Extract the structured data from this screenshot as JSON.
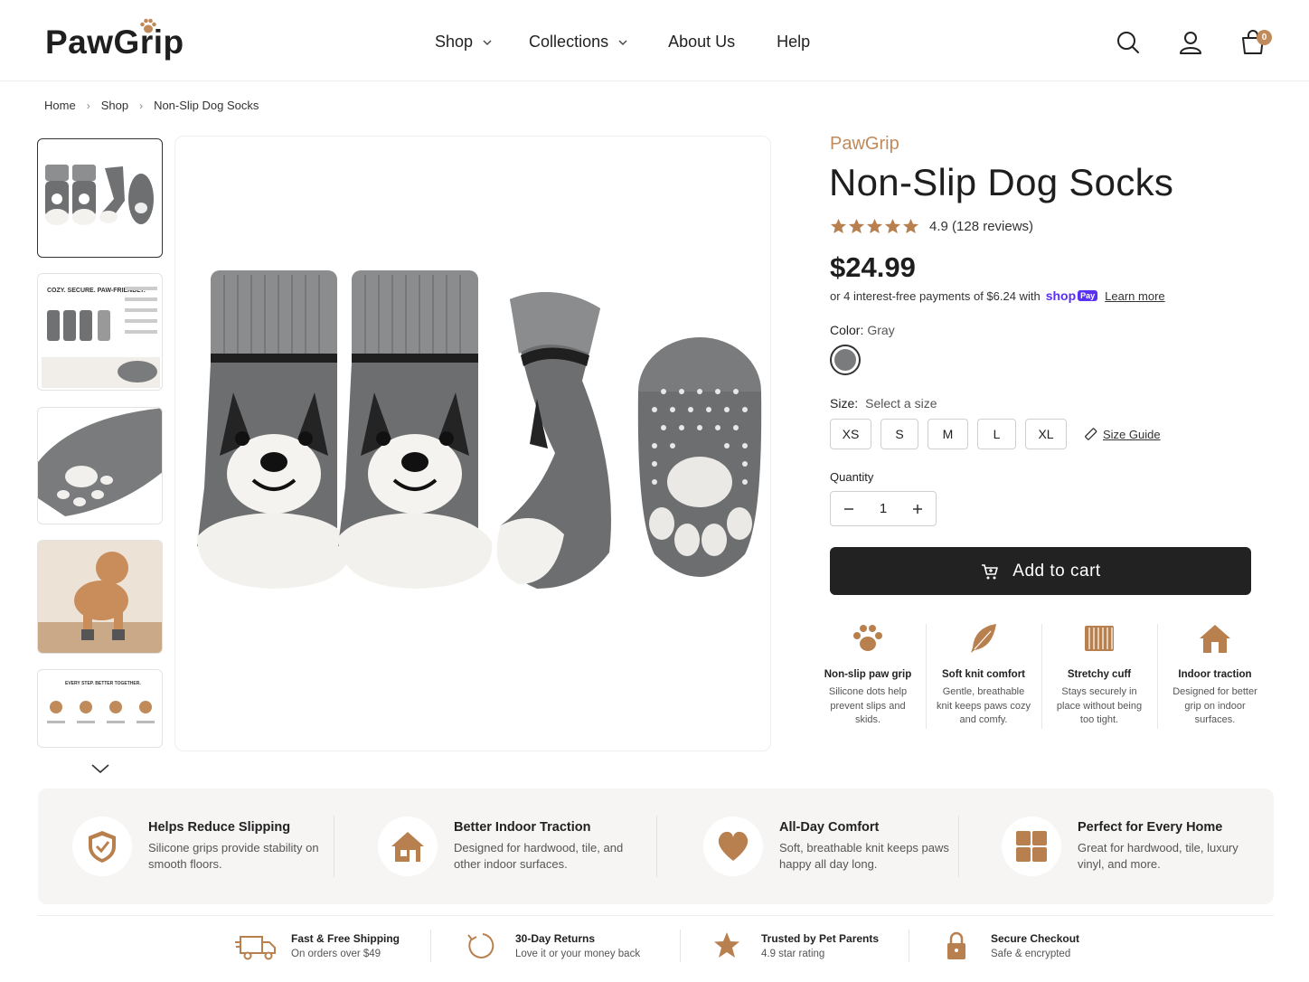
{
  "header": {
    "logo": "PawGrip",
    "nav": [
      {
        "label": "Shop",
        "has_dropdown": true
      },
      {
        "label": "Collections",
        "has_dropdown": true
      },
      {
        "label": "About Us",
        "has_dropdown": false
      },
      {
        "label": "Help",
        "has_dropdown": false
      }
    ],
    "icons": [
      "search-icon",
      "account-icon",
      "cart-icon"
    ],
    "cart_count": "0"
  },
  "breadcrumb": [
    "Home",
    "Shop",
    "Non-Slip Dog Socks"
  ],
  "gallery": {
    "thumbnails": [
      {
        "name": "socks-front",
        "active": true
      },
      {
        "name": "infographic-cozy-secure",
        "text": "COZY. SECURE. PAW-FRIENDLY."
      },
      {
        "name": "sole-closeup"
      },
      {
        "name": "dog-wearing-socks"
      },
      {
        "name": "infographic-every-step",
        "text": "EVERY STEP. BETTER TOGETHER."
      }
    ]
  },
  "product": {
    "brand": "PawGrip",
    "title": "Non-Slip Dog Socks",
    "rating": 4.9,
    "rating_text": "4.9 (128 reviews)",
    "price": "$24.99",
    "installments_prefix": "or 4 interest-free payments of $6.24 with",
    "shop_pay": "shop",
    "shop_pay_badge": "Pay",
    "learn_more": "Learn more",
    "color_label": "Color:",
    "color_value": "Gray",
    "size_label": "Size:",
    "size_value": "Select a size",
    "sizes": [
      "XS",
      "S",
      "M",
      "L",
      "XL"
    ],
    "size_guide": "Size Guide",
    "quantity_label": "Quantity",
    "quantity": "1",
    "add_to_cart": "Add to cart"
  },
  "features": [
    {
      "icon": "paw-icon",
      "title": "Non-slip paw grip",
      "desc": "Silicone dots help prevent slips and skids."
    },
    {
      "icon": "feather-icon",
      "title": "Soft knit comfort",
      "desc": "Gentle, breathable knit keeps paws cozy and comfy."
    },
    {
      "icon": "ribbed-cuff-icon",
      "title": "Stretchy cuff",
      "desc": "Stays securely in place without being too tight."
    },
    {
      "icon": "home-icon",
      "title": "Indoor traction",
      "desc": "Designed for better grip on indoor surfaces."
    }
  ],
  "benefits": [
    {
      "icon": "shield-icon",
      "title": "Helps Reduce Slipping",
      "desc": "Silicone grips provide stability on smooth floors."
    },
    {
      "icon": "house-icon",
      "title": "Better Indoor Traction",
      "desc": "Designed for hardwood, tile, and other indoor surfaces."
    },
    {
      "icon": "heart-icon",
      "title": "All-Day Comfort",
      "desc": "Soft, breathable knit keeps paws happy all day long."
    },
    {
      "icon": "grid-icon",
      "title": "Perfect for Every Home",
      "desc": "Great for hardwood, tile, luxury vinyl, and more."
    }
  ],
  "trust": [
    {
      "icon": "truck-icon",
      "title": "Fast & Free Shipping",
      "desc": "On orders over $49"
    },
    {
      "icon": "returns-icon",
      "title": "30-Day Returns",
      "desc": "Love it or your money back"
    },
    {
      "icon": "star-icon",
      "title": "Trusted by Pet Parents",
      "desc": "4.9 star rating"
    },
    {
      "icon": "lock-icon",
      "title": "Secure Checkout",
      "desc": "Safe & encrypted"
    }
  ],
  "colors": {
    "accent": "#c08a5a",
    "star": "#b8804f",
    "button": "#222222",
    "shop_pay": "#5a31f4",
    "sock_gray": "#7a7b7c"
  }
}
